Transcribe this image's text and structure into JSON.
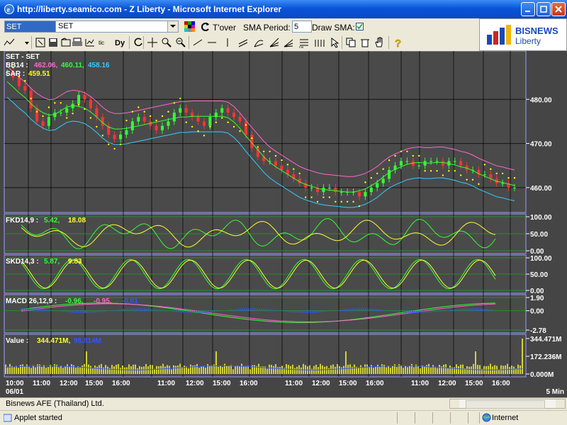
{
  "window": {
    "title": "http://liberty.seamico.com - Z Liberty - Microsoft Internet Explorer"
  },
  "toolbar": {
    "symbol_value": "SET",
    "combo_value": "SET",
    "tover_label": "T'over",
    "sma_period_label": "SMA Period:",
    "sma_period_value": "5",
    "draw_sma_label": "Draw SMA:",
    "draw_sma_checked": true,
    "icons": [
      "line-chart-icon",
      "dropdown-icon",
      "zoom-box-icon",
      "save-icon",
      "open-icon",
      "print-icon",
      "indicator-icon",
      "tic-toc-icon",
      "dy-icon",
      "refresh-icon",
      "crosshair-icon",
      "zoom-in-icon",
      "zoom-out-icon",
      "trendline-icon",
      "horizontal-line-icon",
      "vertical-line-icon",
      "channel-icon",
      "fan-icon",
      "speed-line-icon",
      "fib-fan-icon",
      "fib-retrace-icon",
      "cycle-icon",
      "select-icon",
      "copy-icon",
      "delete-icon",
      "hand-icon",
      "help-icon"
    ]
  },
  "logo": {
    "brand": "BISNEWS",
    "sub": "Liberty",
    "colors": [
      "#1a49b5",
      "#c62828",
      "#f2b705"
    ]
  },
  "chart_data": {
    "type": "line",
    "panels": [
      {
        "name": "price",
        "labels": [
          "SET - SET"
        ],
        "indicators": [
          {
            "key": "BB14",
            "values": [
              "462.06",
              "460.11",
              "458.16"
            ],
            "colors": [
              "#ff66cc",
              "#33ff33",
              "#33ccff"
            ]
          },
          {
            "key": "SAR",
            "values": [
              "459.51"
            ],
            "colors": [
              "#ffff00"
            ]
          }
        ],
        "y_ticks": [
          "480.00",
          "470.00",
          "460.00"
        ],
        "ylim": [
          455,
          490
        ],
        "close": [
          486,
          485,
          483,
          482,
          478,
          475,
          474,
          476,
          477,
          477,
          478,
          479,
          481,
          480,
          478,
          476,
          474,
          472,
          471,
          472,
          473,
          475,
          476,
          475,
          474,
          473,
          474,
          475,
          477,
          478,
          477,
          476,
          475,
          474,
          476,
          477,
          478,
          477,
          476,
          475,
          472,
          469,
          467,
          466,
          466,
          465,
          464,
          463,
          462,
          461,
          460,
          460,
          459,
          460,
          460,
          459,
          459,
          459,
          459,
          458,
          459,
          460,
          461,
          462,
          464,
          465,
          466,
          466,
          465,
          465,
          466,
          466,
          466,
          465,
          466,
          466,
          465,
          464,
          464,
          463,
          463,
          462,
          461,
          461,
          460,
          460
        ]
      },
      {
        "name": "fast-stochastic",
        "labels": [
          "FKD14,9 :"
        ],
        "values_text": [
          "5.42",
          "18.08"
        ],
        "colors": [
          "#33ff33",
          "#ffff33"
        ],
        "y_ticks": [
          "100.00",
          "50.00",
          "0.00"
        ],
        "ylim": [
          0,
          100
        ]
      },
      {
        "name": "slow-stochastic",
        "labels": [
          "SKD14,3 :"
        ],
        "values_text": [
          "5.87",
          "9.83"
        ],
        "colors": [
          "#33ff33",
          "#ffff33"
        ],
        "y_ticks": [
          "100.00",
          "50.00",
          "0.00"
        ],
        "ylim": [
          0,
          100
        ]
      },
      {
        "name": "macd",
        "labels": [
          "MACD 26,12,9 :"
        ],
        "values_text": [
          "-0.96",
          "-0.95",
          "-0.01"
        ],
        "colors": [
          "#33ff33",
          "#ff66cc",
          "#3355ff"
        ],
        "y_ticks": [
          "1.90",
          "0.00",
          "-2.78"
        ],
        "ylim": [
          -2.78,
          1.9
        ]
      },
      {
        "name": "volume",
        "labels": [
          "Value :"
        ],
        "values_text": [
          "344.471M",
          "98.814M"
        ],
        "colors": [
          "#ffff33",
          "#3355ff"
        ],
        "y_ticks": [
          "344.471M",
          "172.236M",
          "0.000M"
        ],
        "ylim": [
          0,
          344.471
        ]
      }
    ],
    "x_ticks": [
      "10:00",
      "11:00",
      "12:00",
      "15:00",
      "16:00",
      "11:00",
      "12:00",
      "15:00",
      "16:00",
      "11:00",
      "12:00",
      "15:00",
      "16:00",
      "11:00",
      "12:00",
      "15:00",
      "16:00"
    ],
    "x_date": "06/01",
    "interval": "5 Min"
  },
  "info": {
    "text": "Bisnews AFE (Thailand) Ltd."
  },
  "status": {
    "text": "Applet started",
    "zone": "Internet"
  }
}
